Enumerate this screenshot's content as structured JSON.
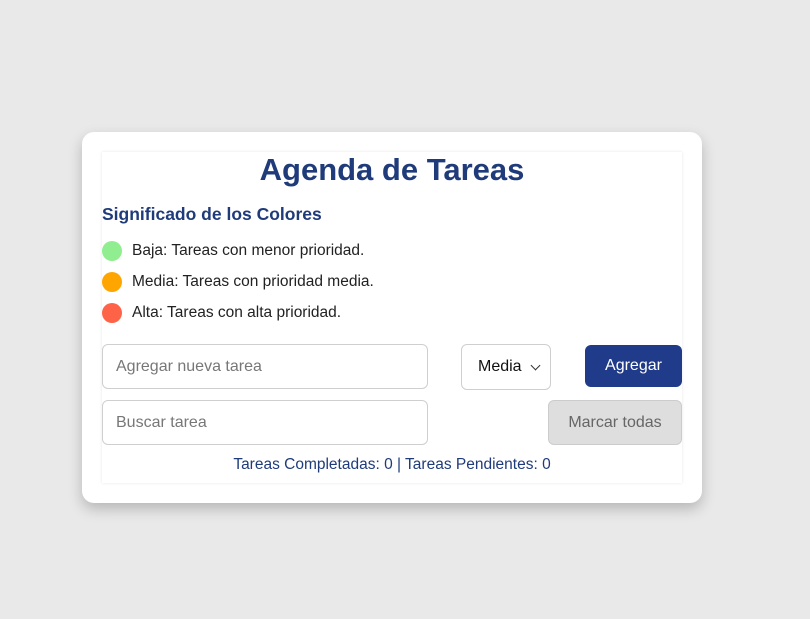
{
  "app": {
    "title": "Agenda de Tareas"
  },
  "legend": {
    "heading": "Significado de los Colores",
    "items": [
      {
        "label": "Baja: Tareas con menor prioridad.",
        "color": "#90ee90"
      },
      {
        "label": "Media: Tareas con prioridad media.",
        "color": "#ffa500"
      },
      {
        "label": "Alta: Tareas con alta prioridad.",
        "color": "#ff6347"
      }
    ]
  },
  "form": {
    "new_task_placeholder": "Agregar nueva tarea",
    "new_task_value": "",
    "priority_selected": "Media",
    "add_label": "Agregar",
    "search_placeholder": "Buscar tarea",
    "search_value": "",
    "mark_all_label": "Marcar todas"
  },
  "stats": {
    "text": "Tareas Completadas: 0 | Tareas Pendientes: 0"
  },
  "colors": {
    "accent": "#1f3b8a",
    "background": "#e9e9e9"
  }
}
